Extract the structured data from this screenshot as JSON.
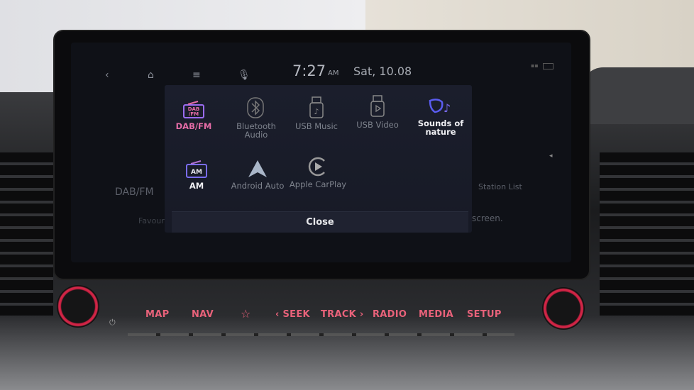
{
  "status_bar": {
    "time": "7:27",
    "ampm": "AM",
    "date": "Sat, 10.08",
    "icons": [
      "back-icon",
      "home-icon",
      "menu-icon",
      "microphone-icon",
      "signal-icon",
      "battery-icon"
    ]
  },
  "background_screen": {
    "source_label": "DAB/FM",
    "station_list": "Station List",
    "favourites_fragment": "Favouri",
    "message_fragment": "screen."
  },
  "media_popup": {
    "items": [
      {
        "label": "DAB/FM",
        "icon": "dab-fm-radio-icon",
        "state": "active",
        "color": "#e46ca6"
      },
      {
        "label": "Bluetooth Audio",
        "icon": "bluetooth-audio-icon",
        "state": "disabled"
      },
      {
        "label": "USB Music",
        "icon": "usb-music-icon",
        "state": "disabled"
      },
      {
        "label": "USB Video",
        "icon": "usb-video-icon",
        "state": "disabled"
      },
      {
        "label": "Sounds of nature",
        "icon": "sounds-of-nature-icon",
        "state": "enabled",
        "color": "#5a5cf0"
      },
      {
        "label": "AM",
        "icon": "am-radio-icon",
        "state": "enabled"
      },
      {
        "label": "Android Auto",
        "icon": "android-auto-icon",
        "state": "disabled"
      },
      {
        "label": "Apple CarPlay",
        "icon": "apple-carplay-icon",
        "state": "disabled"
      }
    ],
    "close_label": "Close"
  },
  "hard_keys": {
    "map": "MAP",
    "nav": "NAV",
    "favourite": "☆",
    "seek": "‹ SEEK",
    "track": "TRACK ›",
    "radio": "RADIO",
    "media": "MEDIA",
    "setup": "SETUP",
    "power": "⏻",
    "accent": "#e8627a"
  }
}
